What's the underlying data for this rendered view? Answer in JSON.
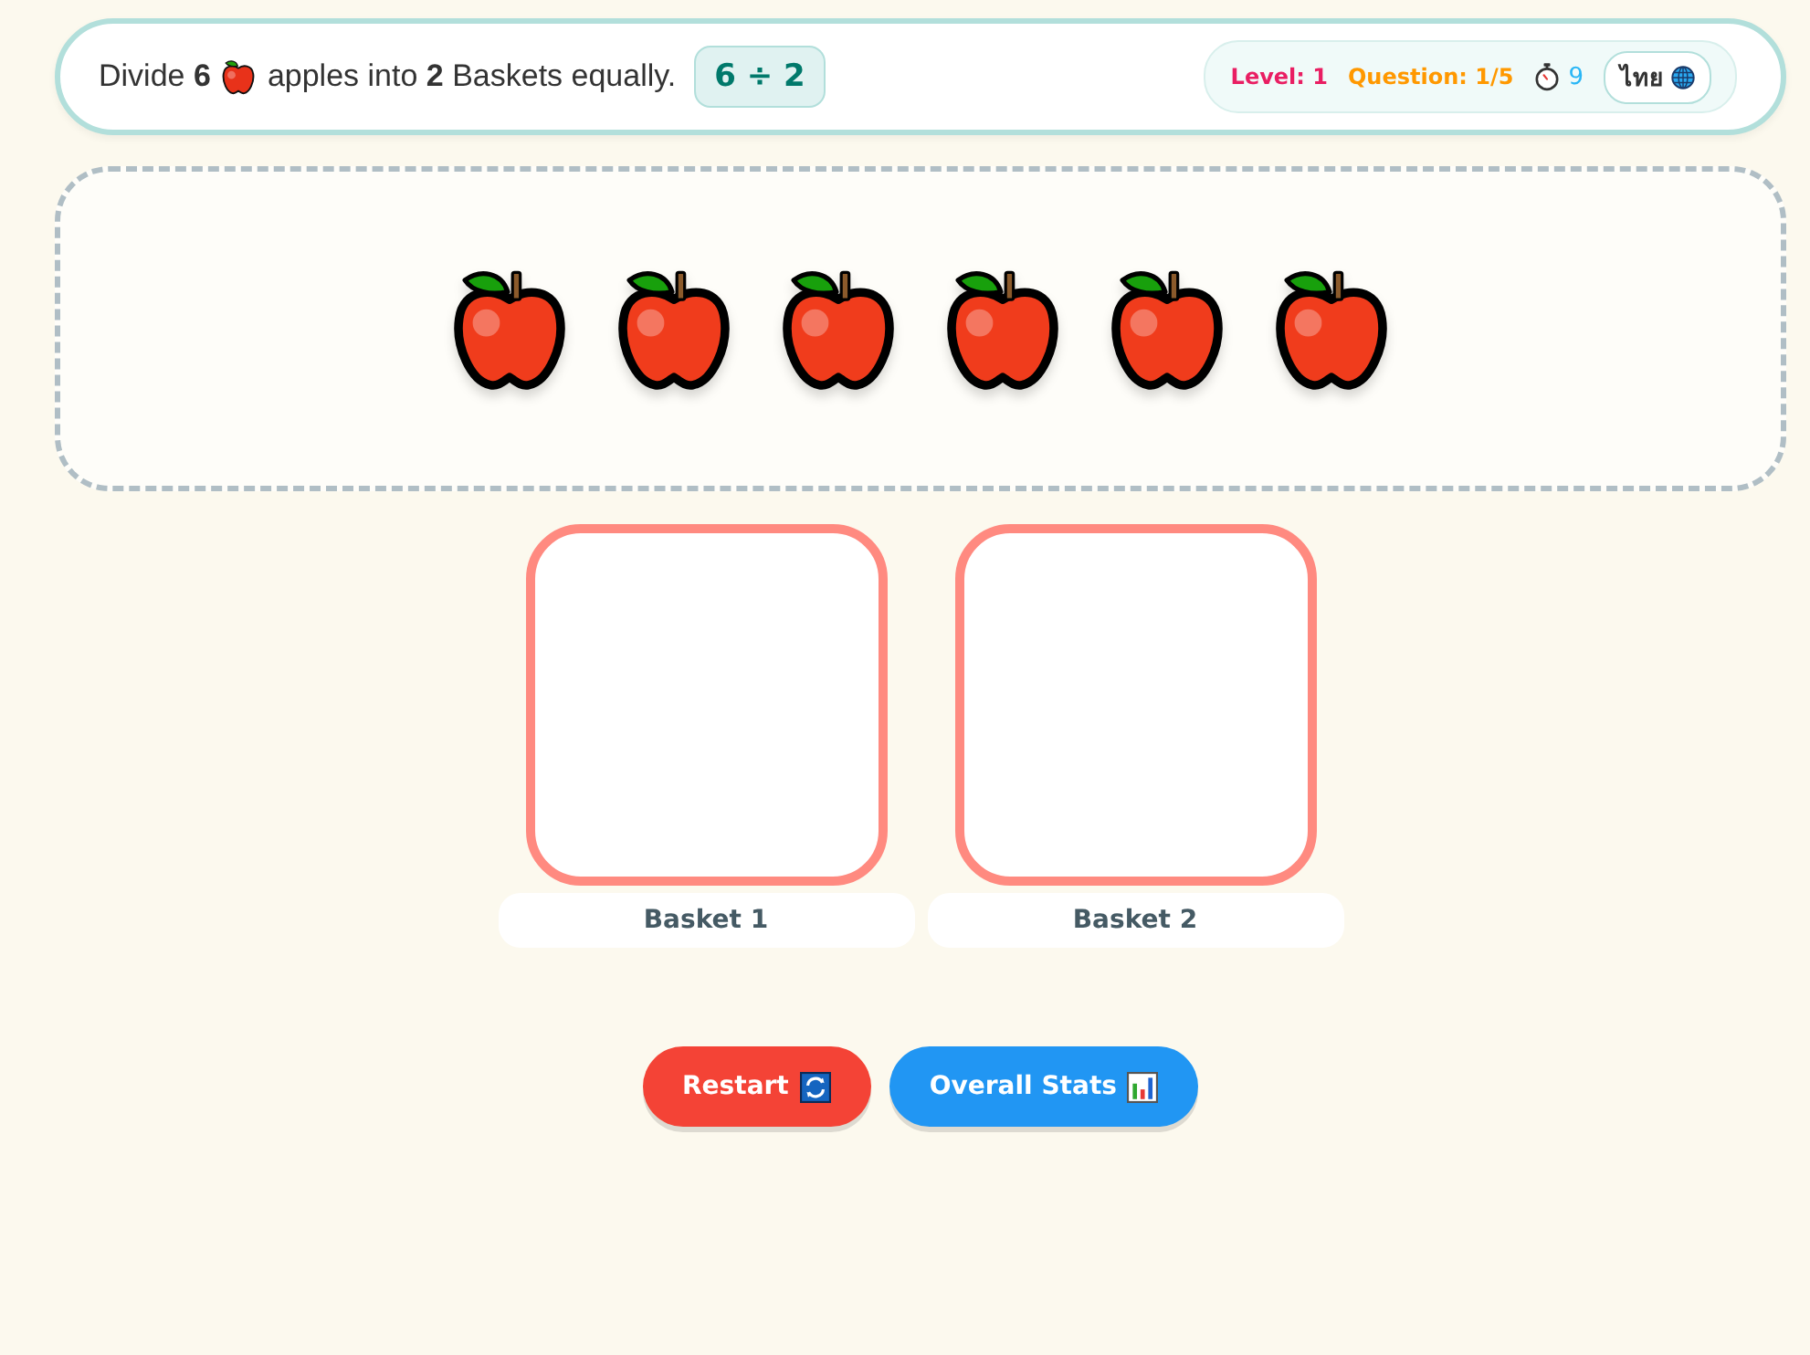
{
  "header": {
    "instruction_start": "Divide **6**",
    "instruction_end": "apples into **2** Baskets equally.",
    "equation": "6 ÷ 2",
    "level": "Level: 1",
    "question": "Question: 1/5",
    "timer": "9",
    "language_button": "ไทย"
  },
  "apples": [
    {
      "kind": "apple"
    },
    {
      "kind": "apple"
    },
    {
      "kind": "apple"
    },
    {
      "kind": "apple"
    },
    {
      "kind": "apple"
    },
    {
      "kind": "apple"
    }
  ],
  "baskets": [
    {
      "label": "Basket 1"
    },
    {
      "label": "Basket 2"
    }
  ],
  "buttons": [
    {
      "label": "Restart",
      "kind": "restart"
    },
    {
      "label": "Overall Stats",
      "kind": "stats"
    }
  ]
}
